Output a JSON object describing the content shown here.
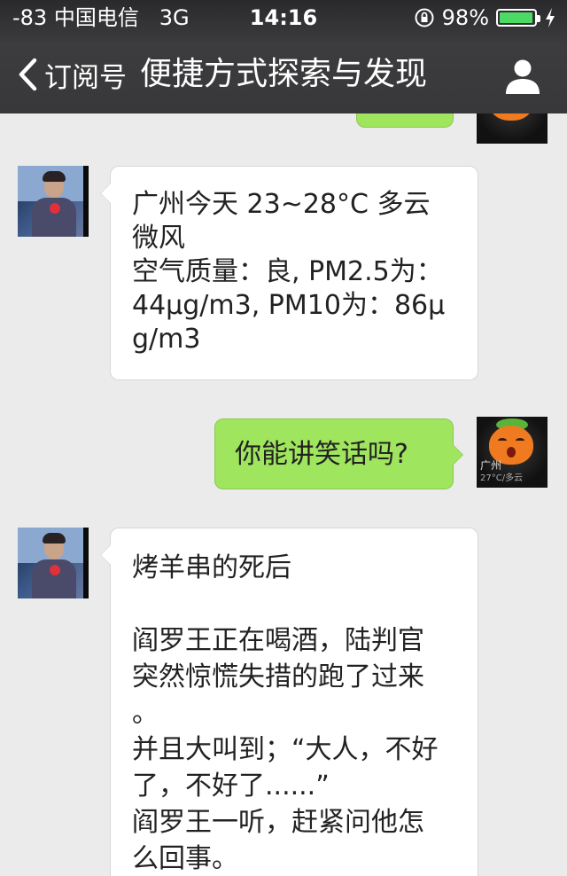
{
  "status_bar": {
    "signal_carrier": "-83 中国电信",
    "network": "3G",
    "time": "14:16",
    "battery_percent": "98%",
    "battery_level": 0.98,
    "battery_color": "#4cd964",
    "icons": [
      "rotation-lock-icon",
      "battery-icon",
      "charging-icon"
    ]
  },
  "nav": {
    "back_label": "订阅号",
    "title": "便捷方式探索与发现",
    "icons": [
      "chevron-left-icon",
      "profile-icon"
    ]
  },
  "messages": [
    {
      "sender": "user",
      "text": ""
    },
    {
      "sender": "bot",
      "text": "广州今天 23~28°C 多云\n微风\n空气质量：良, PM2.5为：\n44μg/m3, PM10为：86μ\ng/m3"
    },
    {
      "sender": "user",
      "text": "你能讲笑话吗?"
    },
    {
      "sender": "bot",
      "text": "烤羊串的死后\n\n阎罗王正在喝酒，陆判官\n突然惊慌失措的跑了过来\n。\n并且大叫到；“大人，不好\n了，不好了......”\n阎罗王一听，赶紧问他怎\n么回事。"
    }
  ],
  "avatar_captions": {
    "user_city": "广州",
    "user_temp": "27°C/多云"
  },
  "colors": {
    "bubble_out": "#a0e55e",
    "bubble_in": "#ffffff",
    "chat_bg": "#ebebeb",
    "nav_bg": "#38383a"
  }
}
